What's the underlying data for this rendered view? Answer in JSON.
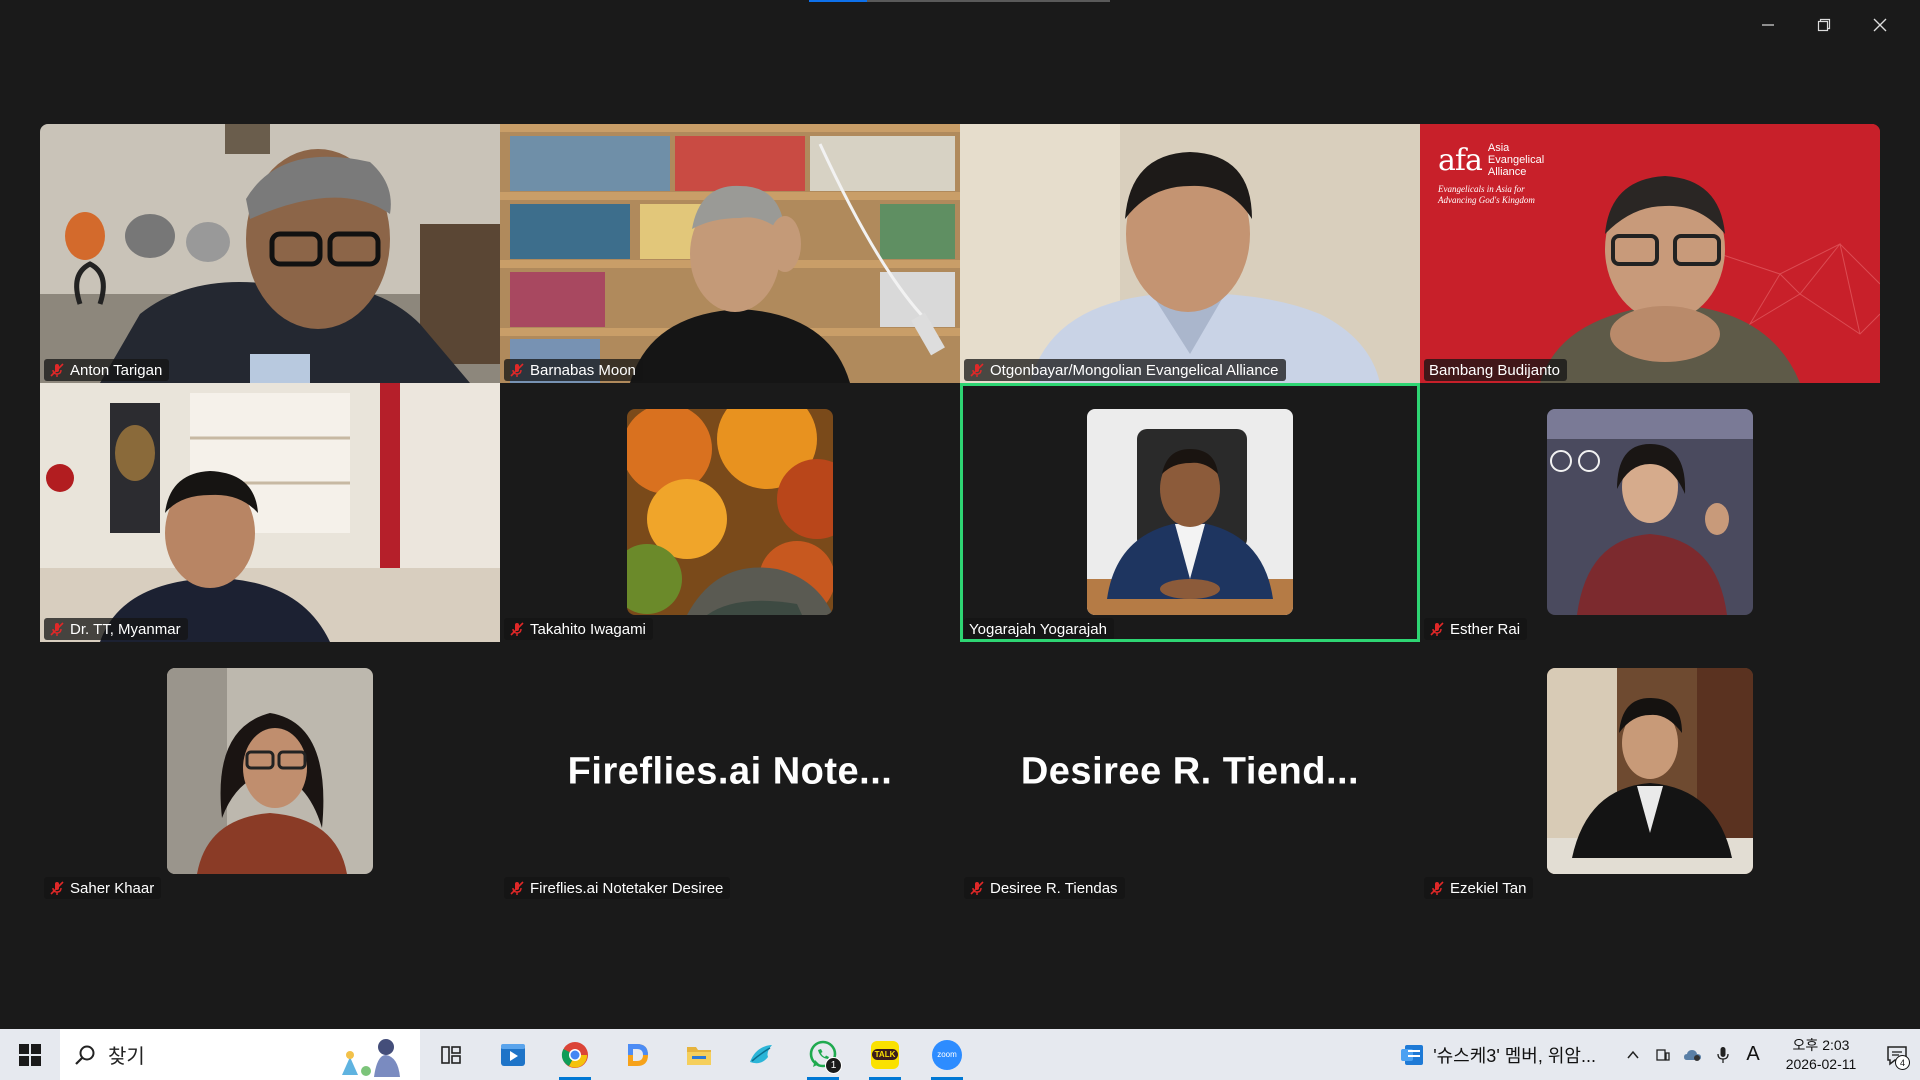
{
  "window": {
    "controls": [
      "minimize",
      "restore",
      "close"
    ]
  },
  "participants": [
    {
      "name": "Anton Tarigan",
      "muted": true,
      "kind": "video"
    },
    {
      "name": "Barnabas Moon",
      "muted": true,
      "kind": "video"
    },
    {
      "name": "Otgonbayar/Mongolian Evangelical Alliance",
      "muted": true,
      "kind": "video"
    },
    {
      "name": "Bambang Budijanto",
      "muted": false,
      "kind": "video",
      "banner": {
        "org_line1": "Asia",
        "org_line2": "Evangelical",
        "org_line3": "Alliance",
        "tagline1": "Evangelicals in Asia for",
        "tagline2": "Advancing God's Kingdom"
      }
    },
    {
      "name": "Dr. TT, Myanmar",
      "muted": true,
      "kind": "video"
    },
    {
      "name": "Takahito Iwagami",
      "muted": true,
      "kind": "photo"
    },
    {
      "name": "Yogarajah Yogarajah",
      "muted": false,
      "kind": "photo",
      "active_speaker": true
    },
    {
      "name": "Esther Rai",
      "muted": true,
      "kind": "photo"
    },
    {
      "name": "Saher Khaar",
      "muted": true,
      "kind": "photo"
    },
    {
      "name": "Fireflies.ai Notetaker Desiree",
      "muted": true,
      "kind": "text",
      "display": "Fireflies.ai  Note..."
    },
    {
      "name": "Desiree R. Tiendas",
      "muted": true,
      "kind": "text",
      "display": "Desiree R. Tiend..."
    },
    {
      "name": "Ezekiel Tan",
      "muted": true,
      "kind": "photo"
    }
  ],
  "colors": {
    "active_speaker_border": "#2ed573",
    "muted_mic": "#e02828",
    "background": "#1a1a1a",
    "banner_red": "#c8202a"
  },
  "taskbar": {
    "search_label": "찾기",
    "apps": [
      "task-view",
      "media-player",
      "chrome",
      "d-app",
      "file-explorer",
      "bird-app",
      "whatsapp",
      "kakaotalk",
      "zoom"
    ],
    "whatsapp_badge": "1",
    "kakaotalk_label": "TALK",
    "zoom_label": "zoom",
    "notification_preview": "'슈스케3' 멤버, 위암...",
    "ime_indicator": "A",
    "clock_time": "오후 2:03",
    "clock_date": "2026-02-11",
    "notification_count": "4"
  }
}
